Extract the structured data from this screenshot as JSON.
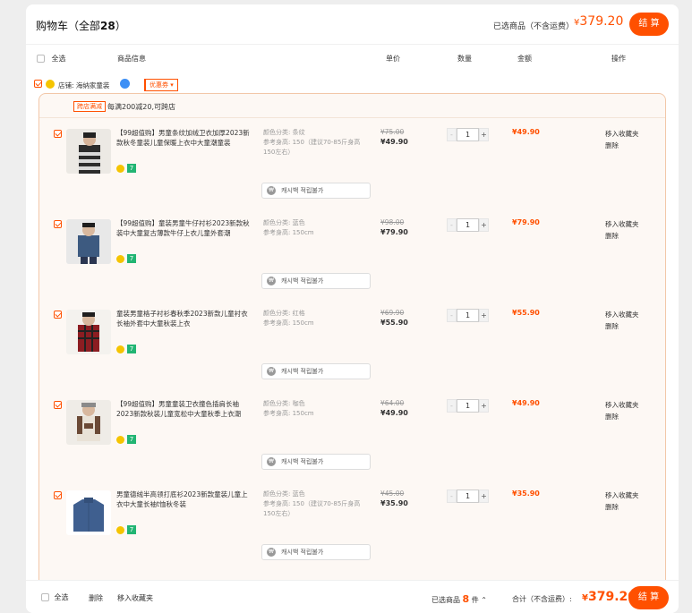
{
  "header": {
    "title": "购物车（全部",
    "count": "28",
    "title_end": "）",
    "selected_label": "已选商品（不含运费）",
    "currency": "¥",
    "selected_amount": "379.20",
    "checkout_label": "结 算"
  },
  "columns": {
    "select_all": "全选",
    "product": "商品信息",
    "unit_price": "单价",
    "quantity": "数量",
    "amount": "金额",
    "actions": "操作"
  },
  "shop": {
    "label": "店铺: 海纳家童装",
    "coupon": "优惠券 ▾"
  },
  "promo": {
    "badge": "跨店满减",
    "text": "每满200减20,可跨店"
  },
  "cash_button_label": "캐시백 적립불가",
  "move_to_fav": "移入收藏夹",
  "delete": "删除",
  "items": [
    {
      "name": "【99超值购】男童条纹加绒卫衣加厚2023新款秋冬童装儿童保暖上衣中大童潮童装",
      "attr1": "颜色分类: 条纹",
      "attr2": "参考身高: 150（建议70-85斤身高150左右）",
      "old_price": "¥75.00",
      "price": "¥49.90",
      "qty": "1",
      "total": "¥49.90"
    },
    {
      "name": "【99超值购】童装男童牛仔衬衫2023新款秋装中大童复古薄款牛仔上衣儿童外套潮",
      "attr1": "颜色分类: 蓝色",
      "attr2": "参考身高: 150cm",
      "old_price": "¥98.00",
      "price": "¥79.90",
      "qty": "1",
      "total": "¥79.90"
    },
    {
      "name": "童装男童格子衬衫春秋季2023新款儿童衬衣长袖外套中大童秋装上衣",
      "attr1": "颜色分类: 红格",
      "attr2": "参考身高: 150cm",
      "old_price": "¥69.90",
      "price": "¥55.90",
      "qty": "1",
      "total": "¥55.90"
    },
    {
      "name": "【99超值购】男童童装卫衣撞色插肩长袖2023新款秋装儿童宽松中大童秋季上衣潮",
      "attr1": "颜色分类: 咖色",
      "attr2": "参考身高: 150cm",
      "old_price": "¥64.00",
      "price": "¥49.90",
      "qty": "1",
      "total": "¥49.90"
    },
    {
      "name": "男童德绒半高领打底衫2023新款童装儿童上衣中大童长袖t恤秋冬装",
      "attr1": "颜色分类: 蓝色",
      "attr2": "参考身高: 150（建议70-85斤身高150左右）",
      "old_price": "¥45.00",
      "price": "¥35.90",
      "qty": "1",
      "total": "¥35.90"
    }
  ],
  "footer": {
    "select_all": "全选",
    "delete": "删除",
    "move_to_fav": "移入收藏夹",
    "selected_prefix": "已选商品",
    "selected_count": "8",
    "selected_suffix": "件 ⌃",
    "total_label": "合计（不含运费）:",
    "currency": "¥",
    "total_amount": "379.20",
    "checkout_label": "结 算"
  },
  "colors": {
    "accent": "#ff5000",
    "item_bg": "#fdf8f4"
  },
  "icons": [
    "checkbox-icon",
    "shop-avatar-icon",
    "wangwang-icon",
    "cashback-icon",
    "plus-icon",
    "minus-icon",
    "chevron-up-icon"
  ]
}
